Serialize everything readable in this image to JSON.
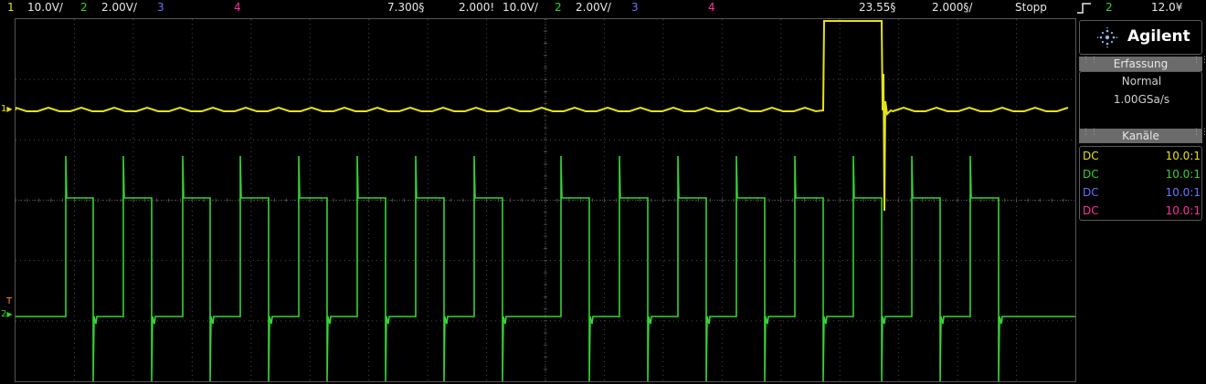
{
  "topbar": {
    "ch1_num": "1",
    "ch1_scale": "10.0V/",
    "ch2_num": "2",
    "ch2_scale": "2.00V/",
    "ch3_num": "3",
    "ch4_num": "4",
    "offset": "7.300§",
    "timebase": "2.000!",
    "ch1_scale_b": "10.0V/",
    "ch2_num_b": "2",
    "ch2_scale_b": "2.00V/",
    "ch3_num_b": "3",
    "ch4_num_b": "4",
    "delay": "23.55§",
    "timebase_b": "2.000§/",
    "run_state": "Stopp",
    "trigger_icon": "rising-edge-icon",
    "trigger_source": "2",
    "trigger_level": "12.0¥"
  },
  "brand": {
    "name": "Agilent",
    "logo": "agilent-spark-icon"
  },
  "acquisition": {
    "header": "Erfassung",
    "mode": "Normal",
    "sample_rate": "1.00GSa/s"
  },
  "channels": {
    "header": "Kanäle",
    "rows": [
      {
        "coupling": "DC",
        "probe": "10.0:1",
        "color": "#e6e21a"
      },
      {
        "coupling": "DC",
        "probe": "10.0:1",
        "color": "#35d335"
      },
      {
        "coupling": "DC",
        "probe": "10.0:1",
        "color": "#6a73ff"
      },
      {
        "coupling": "DC",
        "probe": "10.0:1",
        "color": "#ff3399"
      }
    ]
  },
  "markers": {
    "ch1_label": "1",
    "ch2_label": "2",
    "trig_label": "T"
  },
  "colors": {
    "ch1": "#e6e21a",
    "ch2": "#35d335",
    "ch3": "#6a73ff",
    "ch4": "#ff3399",
    "grid": "#4a4a4a"
  }
}
